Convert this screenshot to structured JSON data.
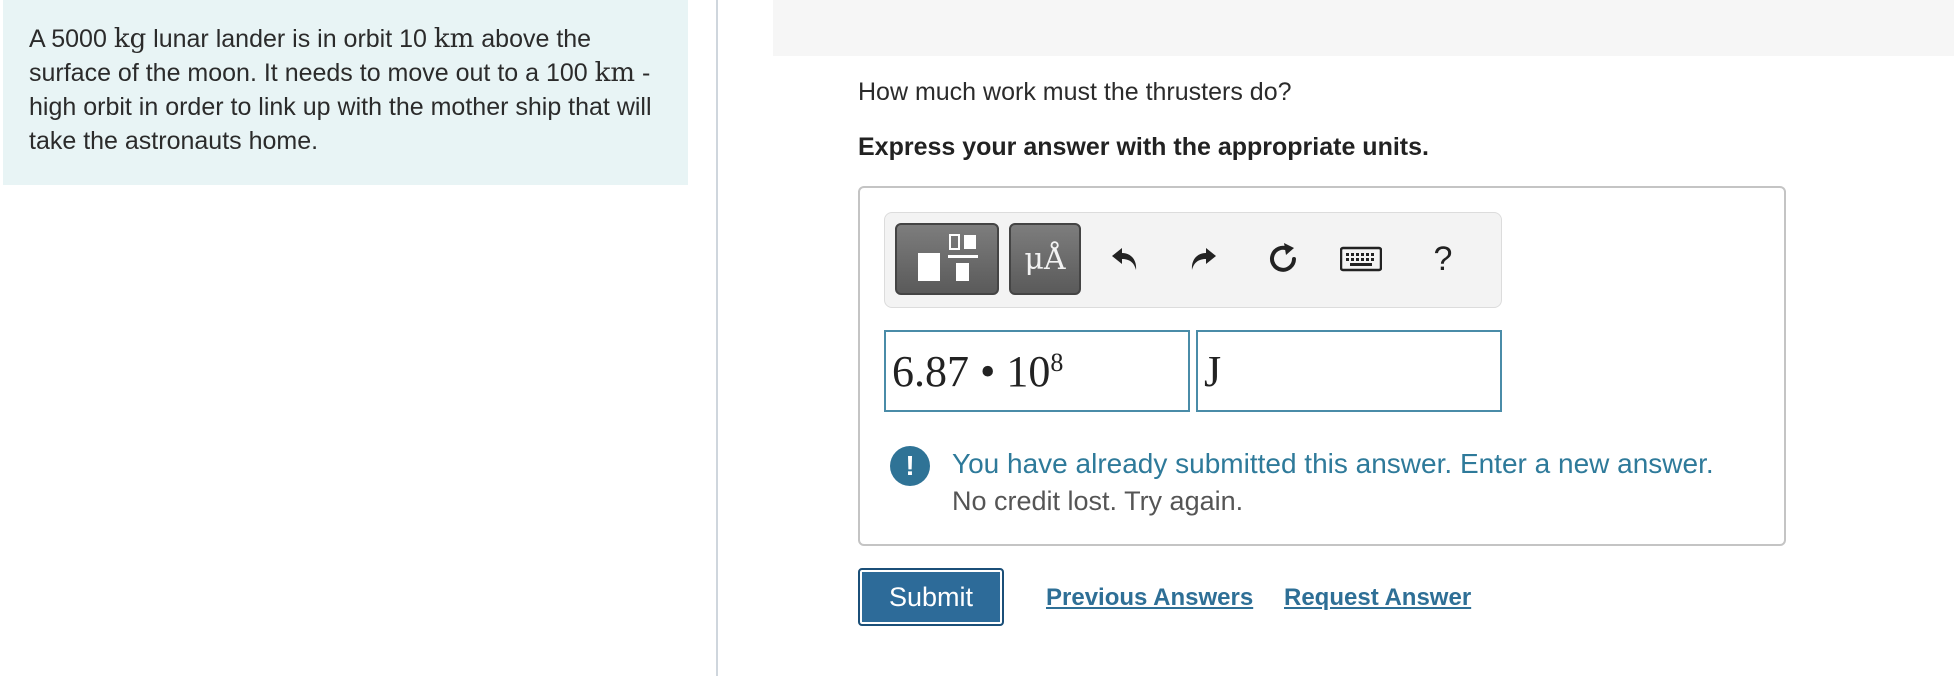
{
  "problem": {
    "part1": "A 5000 ",
    "unit_kg": "kg",
    "part2": " lunar lander is in orbit 10 ",
    "unit_km1": "km",
    "part3": " above the surface of the moon. It needs to move out to a 100 ",
    "unit_km2": "km",
    "part4": " -high orbit in order to link up with the mother ship that will take the astronauts home."
  },
  "question": {
    "text": "How much work must the thrusters do?",
    "instruction": "Express your answer with the appropriate units."
  },
  "toolbar": {
    "templates_icon": "templates-icon",
    "units_label": "μÅ",
    "undo_icon": "undo-icon",
    "redo_icon": "redo-icon",
    "reset_icon": "reset-icon",
    "keyboard_icon": "keyboard-icon",
    "help_label": "?"
  },
  "answer": {
    "value_mantissa": "6.87 • 10",
    "value_exponent": "8",
    "unit": "J"
  },
  "feedback": {
    "icon": "!",
    "message": "You have already submitted this answer. Enter a new answer.",
    "detail": "No credit lost. Try again."
  },
  "actions": {
    "submit_label": "Submit",
    "previous_answers_label": "Previous Answers",
    "request_answer_label": "Request Answer"
  }
}
